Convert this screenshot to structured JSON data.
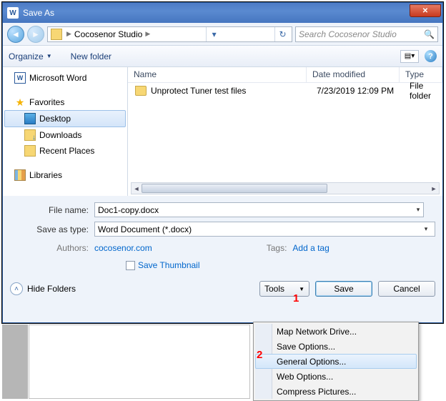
{
  "title": "Save As",
  "breadcrumb": {
    "root": "Cocosenor Studio"
  },
  "search_placeholder": "Search Cocosenor Studio",
  "toolbar": {
    "organize": "Organize",
    "new_folder": "New folder"
  },
  "sidebar": {
    "word": "Microsoft Word",
    "favorites": "Favorites",
    "desktop": "Desktop",
    "downloads": "Downloads",
    "recent": "Recent Places",
    "libraries": "Libraries"
  },
  "columns": {
    "name": "Name",
    "date": "Date modified",
    "type": "Type"
  },
  "files": [
    {
      "name": "Unprotect Tuner test files",
      "date": "7/23/2019 12:09 PM",
      "type": "File folder"
    }
  ],
  "form": {
    "filename_label": "File name:",
    "filename": "Doc1-copy.docx",
    "type_label": "Save as type:",
    "type": "Word Document (*.docx)",
    "authors_label": "Authors:",
    "authors": "cocosenor.com",
    "tags_label": "Tags:",
    "tags": "Add a tag",
    "thumbnail": "Save Thumbnail"
  },
  "footer": {
    "hide": "Hide Folders",
    "tools": "Tools",
    "save": "Save",
    "cancel": "Cancel"
  },
  "menu": {
    "map": "Map Network Drive...",
    "save_opts": "Save Options...",
    "general": "General Options...",
    "web": "Web Options...",
    "compress": "Compress Pictures..."
  },
  "annot": {
    "one": "1",
    "two": "2"
  }
}
